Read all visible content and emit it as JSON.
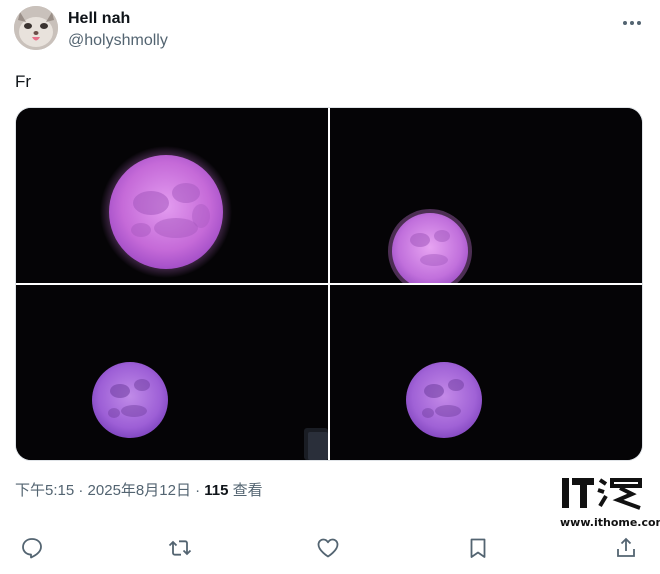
{
  "author": {
    "display_name": "Hell nah",
    "handle": "@holyshmolly"
  },
  "tweet": {
    "text": "Fr"
  },
  "media": {
    "count": 4,
    "moon_color": "#b060d8",
    "background_color": "#050406"
  },
  "meta": {
    "time": "下午5:15",
    "separator_1": " · ",
    "date": "2025年8月12日",
    "separator_2": " · ",
    "views_count": "115",
    "views_label": " 查看"
  },
  "watermark": {
    "url": "www.ithome.com"
  },
  "icons": {
    "more": "more-horizontal-icon",
    "reply": "reply-icon",
    "retweet": "retweet-icon",
    "like": "heart-icon",
    "bookmark": "bookmark-icon",
    "share": "share-icon"
  }
}
